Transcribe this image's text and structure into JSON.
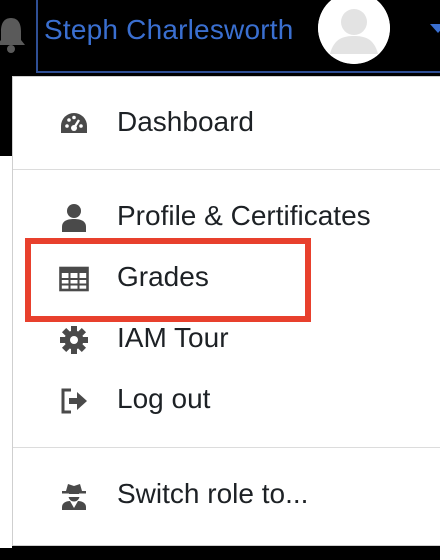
{
  "navbar": {
    "user_name": "Steph Charlesworth",
    "icons": {
      "notifications": "bell-icon",
      "avatar": "default-user-avatar",
      "caret": "caret-down-icon"
    }
  },
  "menu": {
    "items": [
      {
        "label": "Dashboard",
        "icon": "dashboard-gauge-icon"
      },
      {
        "label": "Profile & Certificates",
        "icon": "user-icon"
      },
      {
        "label": "Grades",
        "icon": "table-icon",
        "highlighted": true
      },
      {
        "label": "IAM Tour",
        "icon": "gear-icon"
      },
      {
        "label": "Log out",
        "icon": "sign-out-icon"
      },
      {
        "label": "Switch role to...",
        "icon": "user-secret-icon"
      }
    ]
  },
  "colors": {
    "navbar_bg": "#000000",
    "user_name": "#3a6fd0",
    "icon": "#4a4a4a",
    "text": "#1d2125",
    "highlight_box": "#e8402d"
  }
}
